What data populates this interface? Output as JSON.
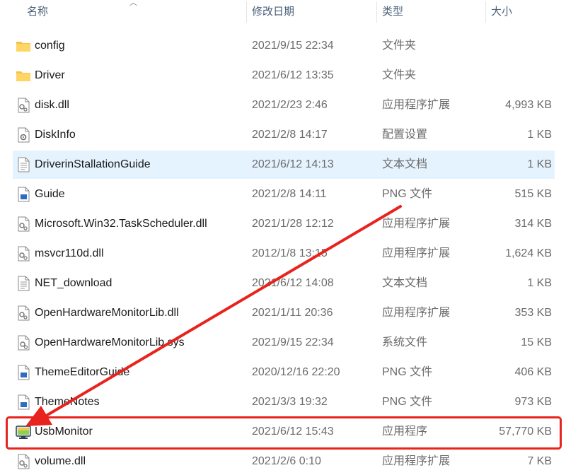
{
  "header": {
    "name": "名称",
    "date": "修改日期",
    "type": "类型",
    "size": "大小"
  },
  "files": [
    {
      "name": "config",
      "date": "2021/9/15 22:34",
      "type": "文件夹",
      "size": "",
      "icon": "folder-icon"
    },
    {
      "name": "Driver",
      "date": "2021/6/12 13:35",
      "type": "文件夹",
      "size": "",
      "icon": "folder-icon"
    },
    {
      "name": "disk.dll",
      "date": "2021/2/23 2:46",
      "type": "应用程序扩展",
      "size": "4,993 KB",
      "icon": "dll-file-icon"
    },
    {
      "name": "DiskInfo",
      "date": "2021/2/8 14:17",
      "type": "配置设置",
      "size": "1 KB",
      "icon": "config-file-icon"
    },
    {
      "name": "DriverinStallationGuide",
      "date": "2021/6/12 14:13",
      "type": "文本文档",
      "size": "1 KB",
      "icon": "text-file-icon",
      "selected": true
    },
    {
      "name": "Guide",
      "date": "2021/2/8 14:11",
      "type": "PNG 文件",
      "size": "515 KB",
      "icon": "image-file-icon"
    },
    {
      "name": "Microsoft.Win32.TaskScheduler.dll",
      "date": "2021/1/28 12:12",
      "type": "应用程序扩展",
      "size": "314 KB",
      "icon": "dll-file-icon"
    },
    {
      "name": "msvcr110d.dll",
      "date": "2012/1/8 13:15",
      "type": "应用程序扩展",
      "size": "1,624 KB",
      "icon": "dll-file-icon"
    },
    {
      "name": "NET_download",
      "date": "2021/6/12 14:08",
      "type": "文本文档",
      "size": "1 KB",
      "icon": "text-file-icon"
    },
    {
      "name": "OpenHardwareMonitorLib.dll",
      "date": "2021/1/11 20:36",
      "type": "应用程序扩展",
      "size": "353 KB",
      "icon": "dll-file-icon"
    },
    {
      "name": "OpenHardwareMonitorLib.sys",
      "date": "2021/9/15 22:34",
      "type": "系统文件",
      "size": "15 KB",
      "icon": "sys-file-icon"
    },
    {
      "name": "ThemeEditorGuide",
      "date": "2020/12/16 22:20",
      "type": "PNG 文件",
      "size": "406 KB",
      "icon": "image-file-icon"
    },
    {
      "name": "ThemeNotes",
      "date": "2021/3/3 19:32",
      "type": "PNG 文件",
      "size": "973 KB",
      "icon": "image-file-icon"
    },
    {
      "name": "UsbMonitor",
      "date": "2021/6/12 15:43",
      "type": "应用程序",
      "size": "57,770 KB",
      "icon": "application-icon"
    },
    {
      "name": "volume.dll",
      "date": "2021/2/6 0:10",
      "type": "应用程序扩展",
      "size": "7 KB",
      "icon": "dll-file-icon"
    }
  ],
  "colors": {
    "annotation": "#e8231d",
    "selection": "#e5f3ff",
    "folder": "#f5c24a"
  }
}
